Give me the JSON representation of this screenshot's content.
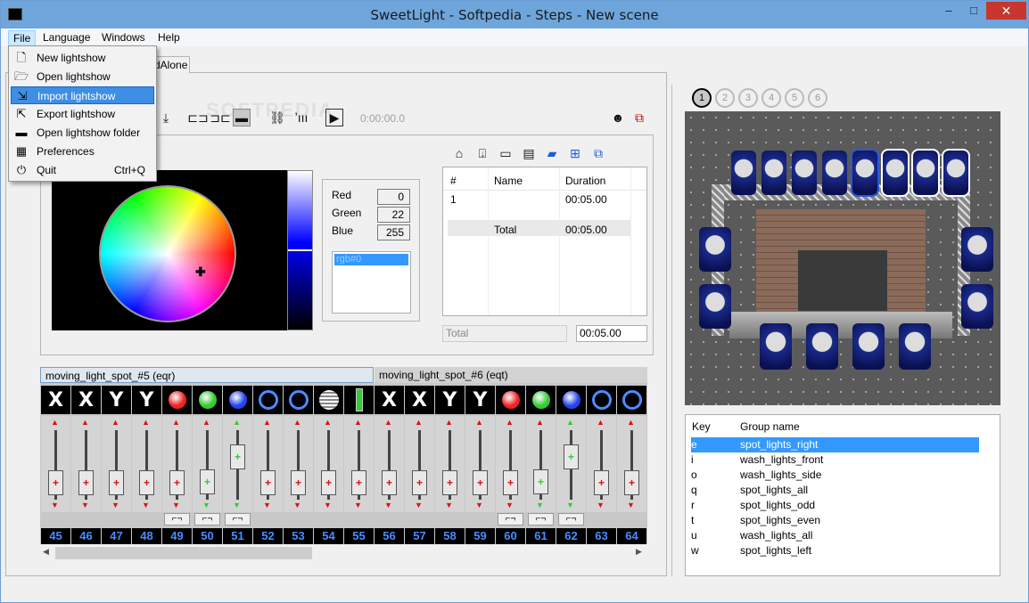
{
  "window": {
    "title": "SweetLight - Softpedia - Steps - New scene",
    "minimize": "–",
    "maximize": "□",
    "close": "✕"
  },
  "menu": [
    "File",
    "Language",
    "Windows",
    "Help"
  ],
  "file_menu": {
    "items": [
      {
        "label": "New lightshow",
        "shortcut": "",
        "icon": "new-file-icon"
      },
      {
        "label": "Open lightshow",
        "shortcut": "",
        "icon": "open-file-icon"
      },
      {
        "label": "Import lightshow",
        "shortcut": "",
        "icon": "import-icon"
      },
      {
        "label": "Export lightshow",
        "shortcut": "",
        "icon": "export-icon"
      },
      {
        "label": "Open lightshow folder",
        "shortcut": "",
        "icon": "folder-icon"
      },
      {
        "label": "Preferences",
        "shortcut": "",
        "icon": "preferences-icon"
      },
      {
        "label": "Quit",
        "shortcut": "Ctrl+Q",
        "icon": "power-icon"
      }
    ],
    "highlighted_index": 2
  },
  "tabs": {
    "standalone": "dAlone"
  },
  "watermark": "SOFTPEDIA",
  "toolbar": {
    "time": "0:00:00.0"
  },
  "color": {
    "labels": {
      "red": "Red",
      "green": "Green",
      "blue": "Blue"
    },
    "values": {
      "red": "0",
      "green": "22",
      "blue": "255"
    },
    "list_item": "rgb#0"
  },
  "steps": {
    "columns": [
      "#",
      "Name",
      "Duration"
    ],
    "rows": [
      {
        "num": "1",
        "name": "",
        "duration": "00:05.00"
      }
    ],
    "total_row": {
      "label": "Total",
      "duration": "00:05.00"
    },
    "footer_label": "Total",
    "footer_value": "00:05.00"
  },
  "channels": {
    "headers": [
      "moving_light_spot_#5 (eqr)",
      "moving_light_spot_#6 (eqt)"
    ],
    "numbers": [
      "45",
      "46",
      "47",
      "48",
      "49",
      "50",
      "51",
      "52",
      "53",
      "54",
      "55",
      "56",
      "57",
      "58",
      "59",
      "60",
      "61",
      "62",
      "63",
      "64"
    ],
    "tiles": [
      "X",
      "X",
      "Y",
      "Y",
      "red-dot-icon",
      "green-dot-icon",
      "blue-dot-icon",
      "ring-icon",
      "rotate-icon",
      "gobo-icon",
      "strip-icon",
      "X",
      "X",
      "Y",
      "Y",
      "red-dot-icon",
      "green-dot-icon",
      "blue-dot-icon",
      "ring-icon",
      "rotate-icon"
    ],
    "fader_levels": [
      0.3,
      0.3,
      0.3,
      0.3,
      0.3,
      0.32,
      0.75,
      0.3,
      0.3,
      0.3,
      0.3,
      0.3,
      0.3,
      0.3,
      0.3,
      0.3,
      0.32,
      0.75,
      0.3,
      0.3
    ]
  },
  "stage": {
    "buttons": [
      "1",
      "2",
      "3",
      "4",
      "5",
      "6"
    ],
    "selected": "1"
  },
  "groups": {
    "columns": [
      "Key",
      "Group name"
    ],
    "rows": [
      {
        "key": "e",
        "name": "spot_lights_right"
      },
      {
        "key": "i",
        "name": "wash_lights_front"
      },
      {
        "key": "o",
        "name": "wash_lights_side"
      },
      {
        "key": "q",
        "name": "spot_lights_all"
      },
      {
        "key": "r",
        "name": "spot_lights_odd"
      },
      {
        "key": "t",
        "name": "spot_lights_even"
      },
      {
        "key": "u",
        "name": "wash_lights_all"
      },
      {
        "key": "w",
        "name": "spot_lights_left"
      }
    ],
    "selected_index": 0
  }
}
